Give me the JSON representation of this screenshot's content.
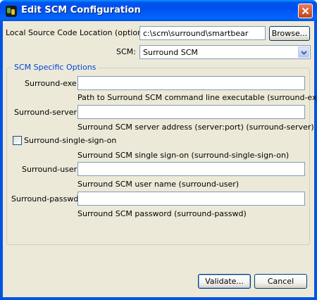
{
  "window": {
    "title": "Edit SCM Configuration"
  },
  "icons": {
    "app": "app-icon",
    "close": "close-icon",
    "dropdown": "chevron-down-icon"
  },
  "form": {
    "location_label": "Local Source Code Location (optional):",
    "location_value": "c:\\scm\\surround\\smartbear",
    "browse_label": "Browse...",
    "scm_label": "SCM:",
    "scm_value": "Surround SCM"
  },
  "group": {
    "title": "SCM Specific Options",
    "exe_label": "Surround-exe:",
    "exe_value": "",
    "exe_help": "Path to Surround SCM command line executable (surround-exe)",
    "server_label": "Surround-server:",
    "server_value": "",
    "server_help": "Surround SCM server address (server:port) (surround-server)",
    "sso_label": "Surround-single-sign-on",
    "sso_checked": false,
    "sso_help": "Surround SCM single sign-on (surround-single-sign-on)",
    "user_label": "Surround-user:",
    "user_value": "",
    "user_help": "Surround SCM user name (surround-user)",
    "passwd_label": "Surround-passwd:",
    "passwd_value": "",
    "passwd_help": "Surround SCM password (surround-passwd)"
  },
  "buttons": {
    "validate": "Validate...",
    "cancel": "Cancel"
  },
  "colors": {
    "titlebar": "#0054e3",
    "dialog_bg": "#ece9d8",
    "group_title": "#0046d5"
  }
}
